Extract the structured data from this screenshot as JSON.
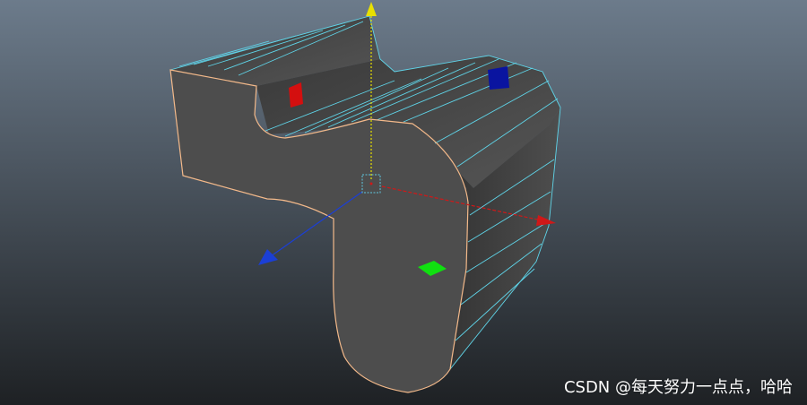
{
  "viewport": {
    "background_top": "#6c7b8b",
    "background_bottom": "#1e2124",
    "object_color": "#4d4d4d",
    "edge_color": "#f3b98a",
    "wire_color": "#5fd4e8"
  },
  "manipulator": {
    "x_axis_color": "#d01818",
    "y_axis_color": "#e8e000",
    "z_axis_color": "#1b3fd6",
    "center_color": "#60c8e0"
  },
  "handles": {
    "red": "#d40f0f",
    "blue": "#0a14a0",
    "green": "#10e010"
  },
  "watermark": {
    "text": "CSDN @每天努力一点点，哈哈"
  }
}
